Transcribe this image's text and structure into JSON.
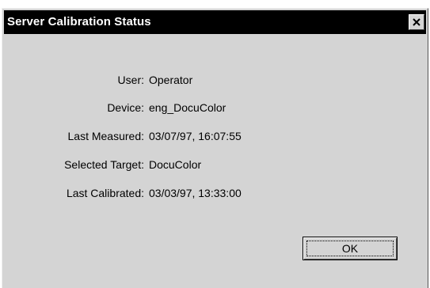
{
  "window": {
    "title": "Server Calibration Status",
    "close_icon": "close-icon"
  },
  "info": {
    "rows": [
      {
        "label": "User:",
        "value": "Operator"
      },
      {
        "label": "Device:",
        "value": "eng_DocuColor"
      },
      {
        "label": "Last Measured:",
        "value": "03/07/97, 16:07:55"
      },
      {
        "label": "Selected Target:",
        "value": "DocuColor"
      },
      {
        "label": "Last Calibrated:",
        "value": "03/03/97, 13:33:00"
      }
    ]
  },
  "buttons": {
    "ok_label": "OK"
  }
}
